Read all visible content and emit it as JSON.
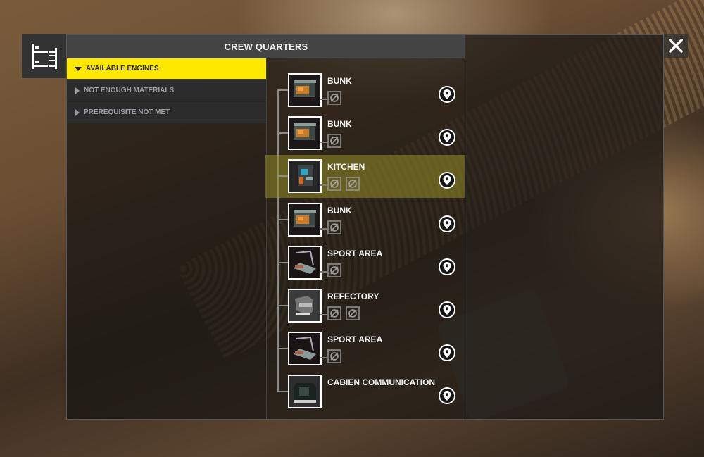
{
  "window": {
    "title": "CREW QUARTERS",
    "category_icon": "bunk-bed-icon",
    "close_icon": "close-icon"
  },
  "categories": [
    {
      "label": "AVAILABLE ENGINES",
      "expanded": true,
      "active": true
    },
    {
      "label": "NOT ENOUGH MATERIALS",
      "expanded": false,
      "active": false
    },
    {
      "label": "PREREQUISITE NOT MET",
      "expanded": false,
      "active": false
    }
  ],
  "colors": {
    "accent": "#ffe800",
    "highlight_row": "#96902a",
    "header_bg": "#444444"
  },
  "items": [
    {
      "name": "BUNK",
      "thumb": "bunk",
      "slots": 1,
      "highlighted": false,
      "slot_icon": "empty-slot-icon",
      "action_icon": "location-pin-icon"
    },
    {
      "name": "BUNK",
      "thumb": "bunk",
      "slots": 1,
      "highlighted": false,
      "slot_icon": "empty-slot-icon",
      "action_icon": "location-pin-icon"
    },
    {
      "name": "KITCHEN",
      "thumb": "kitchen",
      "slots": 2,
      "highlighted": true,
      "slot_icon": "empty-slot-icon",
      "action_icon": "location-pin-icon"
    },
    {
      "name": "BUNK",
      "thumb": "bunk",
      "slots": 1,
      "highlighted": false,
      "slot_icon": "empty-slot-icon",
      "action_icon": "location-pin-icon"
    },
    {
      "name": "SPORT AREA",
      "thumb": "sport",
      "slots": 1,
      "highlighted": false,
      "slot_icon": "empty-slot-icon",
      "action_icon": "location-pin-icon"
    },
    {
      "name": "REFECTORY",
      "thumb": "refectory",
      "slots": 2,
      "highlighted": false,
      "slot_icon": "empty-slot-icon",
      "action_icon": "location-pin-icon"
    },
    {
      "name": "SPORT AREA",
      "thumb": "sport",
      "slots": 1,
      "highlighted": false,
      "slot_icon": "empty-slot-icon",
      "action_icon": "location-pin-icon"
    },
    {
      "name": "CABIEN COMMUNICATION",
      "thumb": "comm",
      "slots": 0,
      "highlighted": false,
      "slot_icon": "empty-slot-icon",
      "action_icon": "location-pin-icon"
    }
  ]
}
